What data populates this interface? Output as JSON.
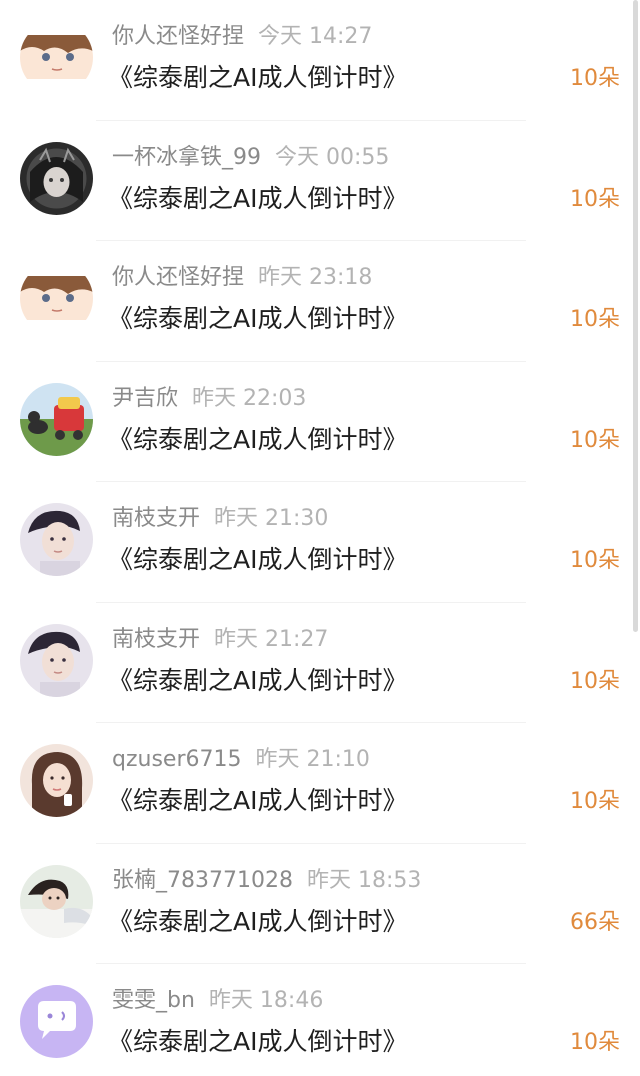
{
  "accent_color": "#e08a3c",
  "items": [
    {
      "name": "你人还怪好捏",
      "time": "今天 14:27",
      "title": "《综泰剧之AI成人倒计时》",
      "amount": "10朵",
      "avatar": "anime-boy-avatar-icon"
    },
    {
      "name": "一杯冰拿铁_99",
      "time": "今天 00:55",
      "title": "《综泰剧之AI成人倒计时》",
      "amount": "10朵",
      "avatar": "dark-anime-girl-avatar-icon"
    },
    {
      "name": "你人还怪好捏",
      "time": "昨天 23:18",
      "title": "《综泰剧之AI成人倒计时》",
      "amount": "10朵",
      "avatar": "anime-boy-avatar-icon"
    },
    {
      "name": "尹吉欣",
      "time": "昨天 22:03",
      "title": "《综泰剧之AI成人倒计时》",
      "amount": "10朵",
      "avatar": "dog-and-cart-avatar-icon"
    },
    {
      "name": "南枝支开",
      "time": "昨天 21:30",
      "title": "《综泰剧之AI成人倒计时》",
      "amount": "10朵",
      "avatar": "man-portrait-avatar-icon"
    },
    {
      "name": "南枝支开",
      "time": "昨天 21:27",
      "title": "《综泰剧之AI成人倒计时》",
      "amount": "10朵",
      "avatar": "man-portrait-avatar-icon"
    },
    {
      "name": "qzuser6715",
      "time": "昨天 21:10",
      "title": "《综泰剧之AI成人倒计时》",
      "amount": "10朵",
      "avatar": "woman-portrait-avatar-icon"
    },
    {
      "name": "张楠_783771028",
      "time": "昨天 18:53",
      "title": "《综泰剧之AI成人倒计时》",
      "amount": "66朵",
      "avatar": "woman-lying-avatar-icon"
    },
    {
      "name": "雯雯_bn",
      "time": "昨天 18:46",
      "title": "《综泰剧之AI成人倒计时》",
      "amount": "10朵",
      "avatar": "chat-bubble-avatar-icon"
    }
  ]
}
